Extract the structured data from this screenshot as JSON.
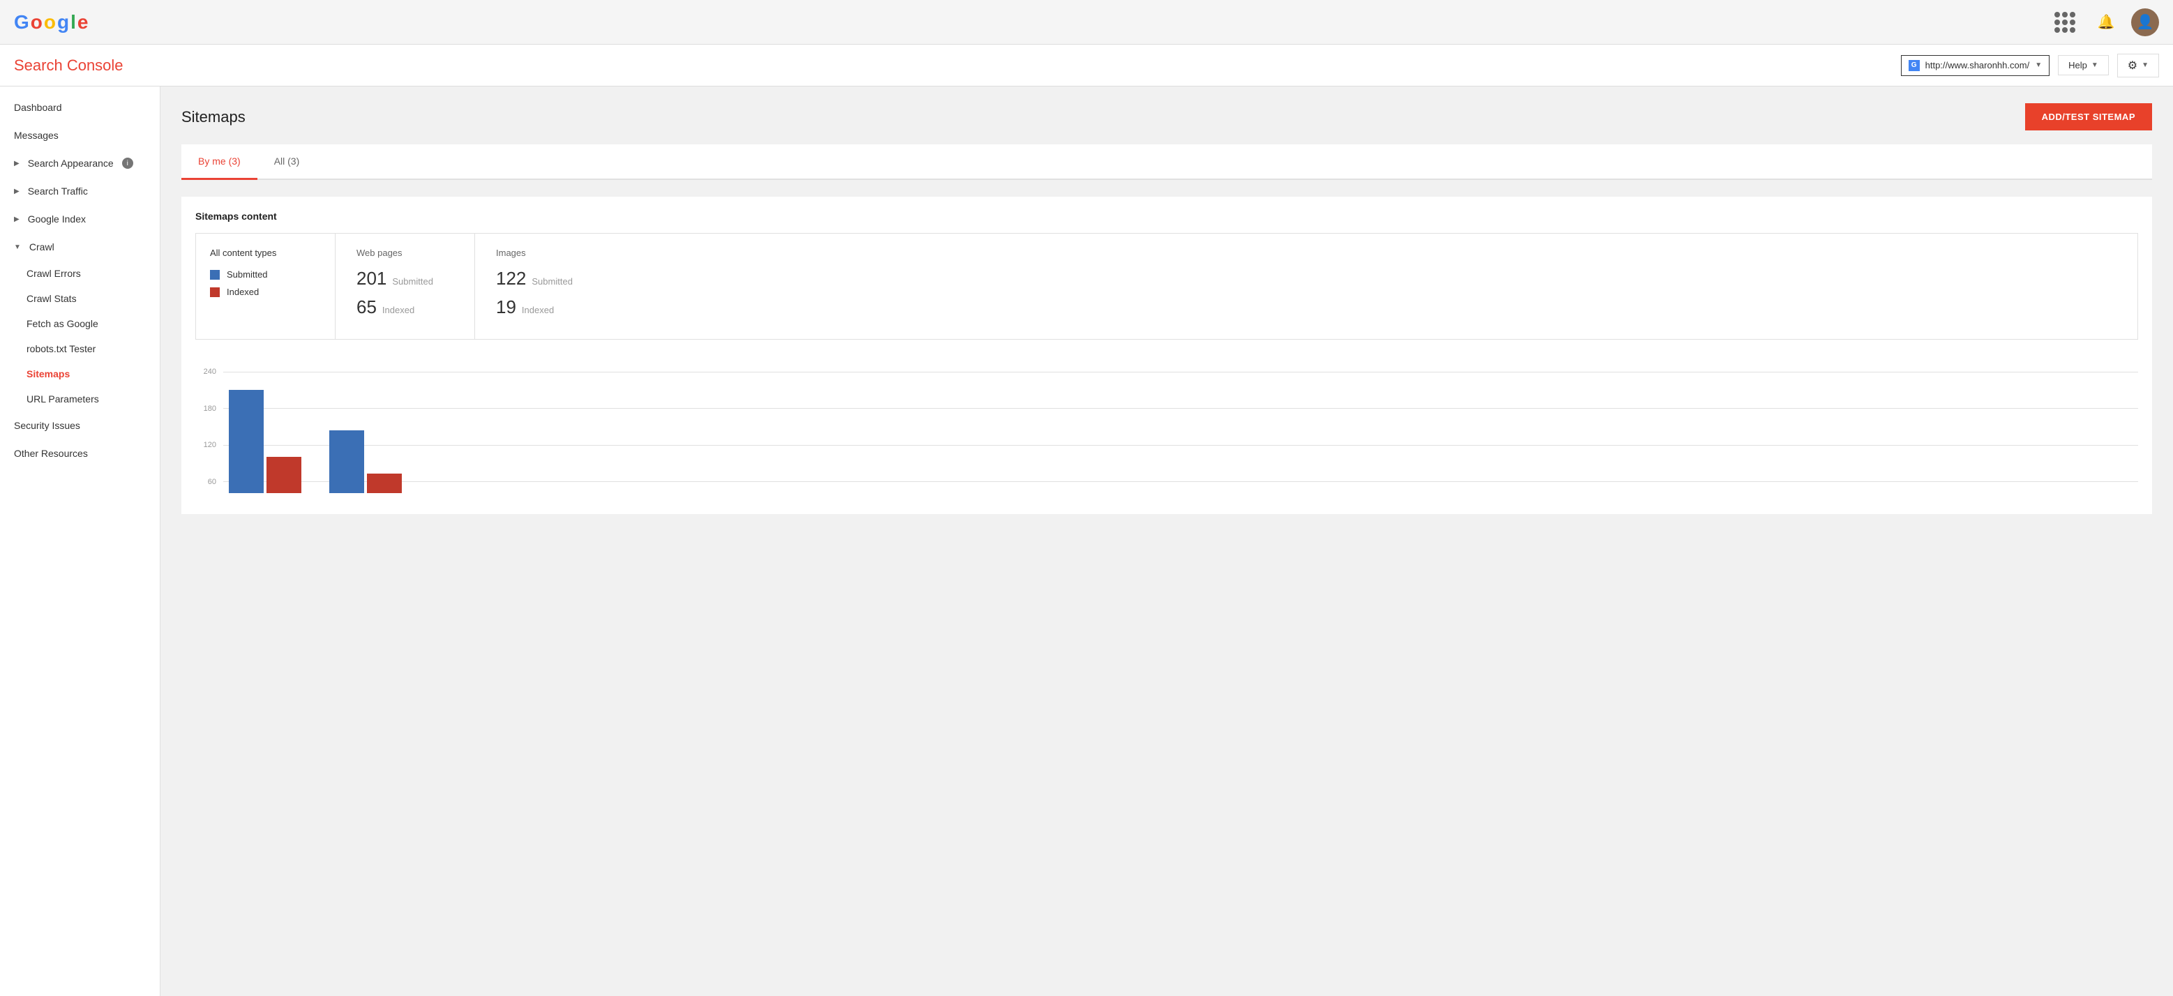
{
  "header": {
    "logo": "Google",
    "logo_letters": [
      {
        "char": "G",
        "color": "#4285F4"
      },
      {
        "char": "o",
        "color": "#EA4335"
      },
      {
        "char": "o",
        "color": "#FBBC05"
      },
      {
        "char": "g",
        "color": "#4285F4"
      },
      {
        "char": "l",
        "color": "#34A853"
      },
      {
        "char": "e",
        "color": "#EA4335"
      }
    ]
  },
  "search_console": {
    "title": "Search Console",
    "site_url": "http://www.sharonhh.com/",
    "help_label": "Help",
    "gear_label": "⚙"
  },
  "sidebar": {
    "dashboard_label": "Dashboard",
    "messages_label": "Messages",
    "search_appearance_label": "Search Appearance",
    "search_traffic_label": "Search Traffic",
    "google_index_label": "Google Index",
    "crawl_label": "Crawl",
    "crawl_errors_label": "Crawl Errors",
    "crawl_stats_label": "Crawl Stats",
    "fetch_as_google_label": "Fetch as Google",
    "robots_txt_label": "robots.txt Tester",
    "sitemaps_label": "Sitemaps",
    "url_parameters_label": "URL Parameters",
    "security_issues_label": "Security Issues",
    "other_resources_label": "Other Resources"
  },
  "page": {
    "title": "Sitemaps",
    "add_btn": "ADD/TEST SITEMAP"
  },
  "tabs": [
    {
      "label": "By me (3)",
      "active": true
    },
    {
      "label": "All (3)",
      "active": false
    }
  ],
  "sitemaps_content": {
    "section_title": "Sitemaps content",
    "content_type_label": "All content types",
    "submitted_label": "Submitted",
    "indexed_label": "Indexed",
    "web_pages_label": "Web pages",
    "web_submitted": "201",
    "web_submitted_label": "Submitted",
    "web_indexed": "65",
    "web_indexed_label": "Indexed",
    "images_label": "Images",
    "img_submitted": "122",
    "img_submitted_label": "Submitted",
    "img_indexed": "19",
    "img_indexed_label": "Indexed"
  },
  "chart": {
    "y_labels": [
      "240",
      "180",
      "120",
      "60"
    ],
    "bars": [
      {
        "blue_height": 148,
        "red_height": 52
      },
      {
        "blue_height": 90,
        "red_height": 28
      }
    ],
    "blue_color": "#3B6FB5",
    "red_color": "#C0392B"
  },
  "legend": {
    "submitted_color": "#3B6FB5",
    "indexed_color": "#C0392B"
  }
}
